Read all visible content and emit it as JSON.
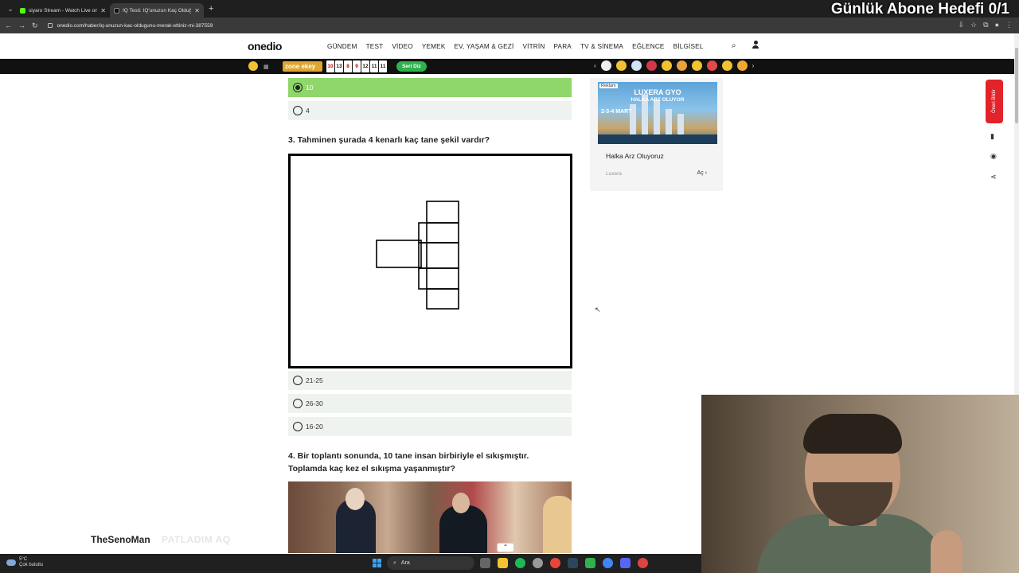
{
  "overlay": {
    "title": "Günlük Abone Hedefi 0/1"
  },
  "browser": {
    "tabs": [
      {
        "label": "siyaro Stream - Watch Live on Ki",
        "favicon_color": "#53fc18",
        "active": false
      },
      {
        "label": "IQ Testi: IQ'unuzun Kaç Olduğu",
        "favicon_color": "#222222",
        "active": true
      }
    ],
    "new_tab": "+",
    "url": "onedio.com/haber/iq-unuzun-kac-oldugunu-merak-ettiniz-mi-387559"
  },
  "site": {
    "logo": "onedio",
    "menu": [
      "GÜNDEM",
      "TEST",
      "VİDEO",
      "YEMEK",
      "EV, YAŞAM & GEZİ",
      "VİTRİN",
      "PARA",
      "TV & SİNEMA",
      "EĞLENCE",
      "BİLGİSEL"
    ],
    "subbar": {
      "zone_label": "zone ekey",
      "cards": [
        "10",
        "13",
        "8",
        "9",
        "12",
        "11",
        "11"
      ],
      "seri_label": "Seri Diz"
    }
  },
  "quiz": {
    "prev_options": [
      {
        "label": "10",
        "selected": true
      },
      {
        "label": "4",
        "selected": false
      }
    ],
    "question3": {
      "title": "3. Tahminen şurada 4 kenarlı kaç tane şekil vardır?",
      "options": [
        "21-25",
        "26-30",
        "16-20"
      ]
    },
    "question4": {
      "title_line1": "4. Bir toplantı sonunda, 10 tane insan birbiriyle el sıkışmıştır.",
      "title_line2": "Toplamda kaç kez el sıkışma yaşanmıştır?"
    }
  },
  "ad": {
    "badge": "Reklam",
    "brand": "LUXERA GYO",
    "headline": "HALKA ARZ OLUYOR",
    "dates": "2-3-4 MART",
    "text": "Halka Arz Oluyoruz",
    "sponsor": "Luxera",
    "open_label": "Aç"
  },
  "sidebar": {
    "suggest_label": "Öneri Bildir"
  },
  "stream": {
    "streamer": "TheSenoMan",
    "caption": "PATLADIM AQ"
  },
  "taskbar": {
    "weather_temp": "5°C",
    "weather_desc": "Çok bulutlu",
    "search_placeholder": "Ara"
  }
}
